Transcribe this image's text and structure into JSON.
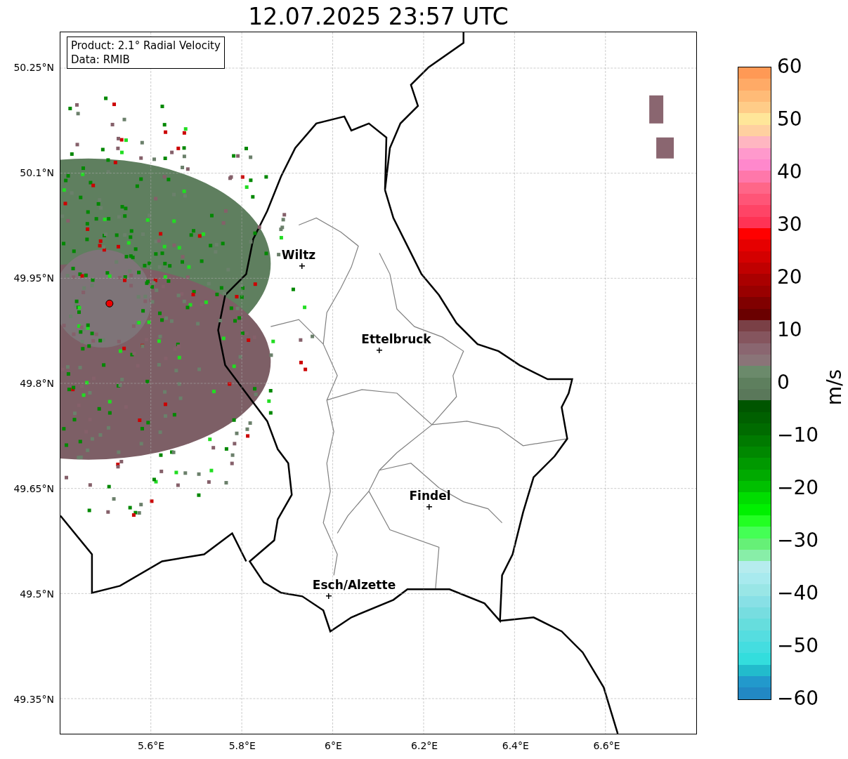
{
  "title": "12.07.2025 23:57 UTC",
  "legend": {
    "lines": [
      "Product: 2.1° Radial Velocity",
      "Data: RMIB"
    ]
  },
  "map": {
    "y_ticks": [
      "50.25°N",
      "50.1°N",
      "49.95°N",
      "49.8°N",
      "49.65°N",
      "49.5°N",
      "49.35°N"
    ],
    "x_ticks": [
      "5.6°E",
      "5.8°E",
      "6°E",
      "6.2°E",
      "6.4°E",
      "6.6°E"
    ],
    "cities": [
      {
        "name": "Wiltz"
      },
      {
        "name": "Ettelbruck"
      },
      {
        "name": "Findel"
      },
      {
        "name": "Esch/Alzette"
      }
    ]
  },
  "colorbar": {
    "label": "m/s",
    "ticks": [
      "60",
      "50",
      "40",
      "30",
      "20",
      "10",
      "0",
      "−10",
      "−20",
      "−30",
      "−40",
      "−50",
      "−60"
    ]
  }
}
